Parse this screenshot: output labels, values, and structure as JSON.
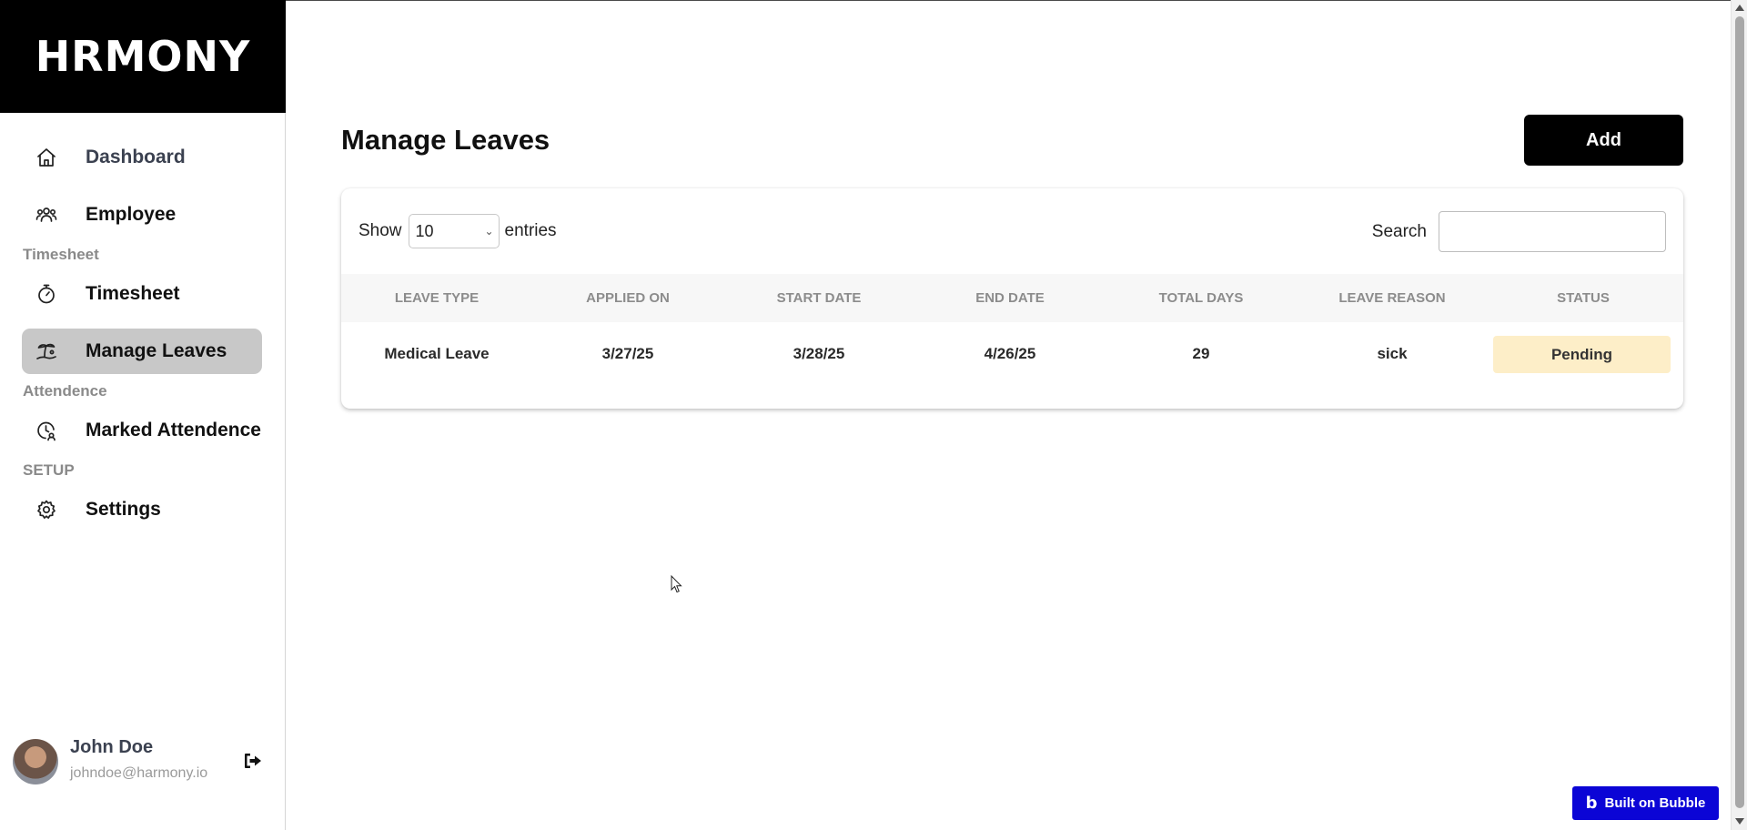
{
  "app": {
    "logo": "HRMONY",
    "built_on": "Built on Bubble"
  },
  "sidebar": {
    "items": [
      {
        "label": "Dashboard",
        "icon": "home-icon"
      },
      {
        "label": "Employee",
        "icon": "users-icon"
      }
    ],
    "timesheet_section": "Timesheet",
    "timesheet_items": [
      {
        "label": "Timesheet",
        "icon": "stopwatch-icon"
      },
      {
        "label": "Manage Leaves",
        "icon": "beach-icon",
        "active": true
      }
    ],
    "attendance_section": "Attendence",
    "attendance_items": [
      {
        "label": "Marked Attendence",
        "icon": "clock-check-icon"
      }
    ],
    "setup_section": "SETUP",
    "setup_items": [
      {
        "label": "Settings",
        "icon": "gear-icon"
      }
    ]
  },
  "user": {
    "name": "John Doe",
    "email": "johndoe@harmony.io"
  },
  "main": {
    "title": "Manage Leaves",
    "add_label": "Add",
    "show_label": "Show",
    "entries_value": "10",
    "entries_label": "entries",
    "search_label": "Search",
    "search_value": ""
  },
  "table": {
    "headers": [
      "LEAVE TYPE",
      "APPLIED ON",
      "START DATE",
      "END DATE",
      "TOTAL DAYS",
      "LEAVE REASON",
      "STATUS"
    ],
    "rows": [
      {
        "leave_type": "Medical Leave",
        "applied_on": "3/27/25",
        "start_date": "3/28/25",
        "end_date": "4/26/25",
        "total_days": "29",
        "leave_reason": "sick",
        "status": "Pending"
      }
    ]
  },
  "colors": {
    "sidebar_active": "#c8c8c8",
    "status_pending_bg": "#fdeec8",
    "bubble_blue": "#0b05d6",
    "primary_button": "#000000"
  }
}
